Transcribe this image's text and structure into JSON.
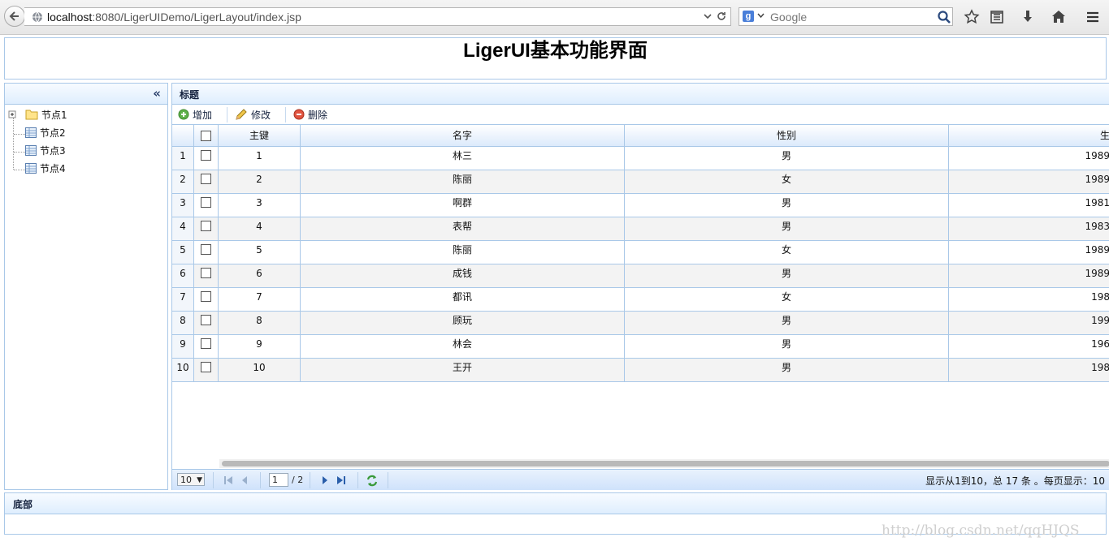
{
  "browser": {
    "url_host": "localhost",
    "url_rest": ":8080/LigerUIDemo/LigerLayout/index.jsp",
    "search_placeholder": "Google",
    "search_engine_badge": "g"
  },
  "page": {
    "title": "LigerUI基本功能界面"
  },
  "left_panel": {
    "collapse_glyph": "«",
    "tree": [
      {
        "label": "节点1",
        "icon": "folder-icon",
        "expander": "plus-expand-icon"
      },
      {
        "label": "节点2",
        "icon": "grid-page-icon"
      },
      {
        "label": "节点3",
        "icon": "grid-page-icon"
      },
      {
        "label": "节点4",
        "icon": "grid-page-icon"
      }
    ]
  },
  "main_panel": {
    "title": "标题",
    "toolbar": [
      {
        "label": "增加",
        "icon": "add-icon"
      },
      {
        "label": "修改",
        "icon": "pencil-icon"
      },
      {
        "label": "删除",
        "icon": "delete-icon"
      }
    ],
    "columns": [
      "主键",
      "名字",
      "性别",
      "生"
    ],
    "rows": [
      {
        "n": "1",
        "id": "1",
        "name": "林三",
        "sex": "男",
        "birth": "1989"
      },
      {
        "n": "2",
        "id": "2",
        "name": "陈丽",
        "sex": "女",
        "birth": "1989"
      },
      {
        "n": "3",
        "id": "3",
        "name": "啊群",
        "sex": "男",
        "birth": "1981"
      },
      {
        "n": "4",
        "id": "4",
        "name": "表帮",
        "sex": "男",
        "birth": "1983"
      },
      {
        "n": "5",
        "id": "5",
        "name": "陈丽",
        "sex": "女",
        "birth": "1989"
      },
      {
        "n": "6",
        "id": "6",
        "name": "成钱",
        "sex": "男",
        "birth": "1989"
      },
      {
        "n": "7",
        "id": "7",
        "name": "都讯",
        "sex": "女",
        "birth": "198"
      },
      {
        "n": "8",
        "id": "8",
        "name": "顾玩",
        "sex": "男",
        "birth": "199"
      },
      {
        "n": "9",
        "id": "9",
        "name": "林会",
        "sex": "男",
        "birth": "196"
      },
      {
        "n": "10",
        "id": "10",
        "name": "王开",
        "sex": "男",
        "birth": "198"
      }
    ],
    "pager": {
      "page_size": "10",
      "current_page": "1",
      "total_pages": "/ 2",
      "info": "显示从1到10，总 17 条 。每页显示：10"
    }
  },
  "bottom_panel": {
    "title": "底部"
  },
  "watermark": "http://blog.csdn.net/qqHJQS"
}
